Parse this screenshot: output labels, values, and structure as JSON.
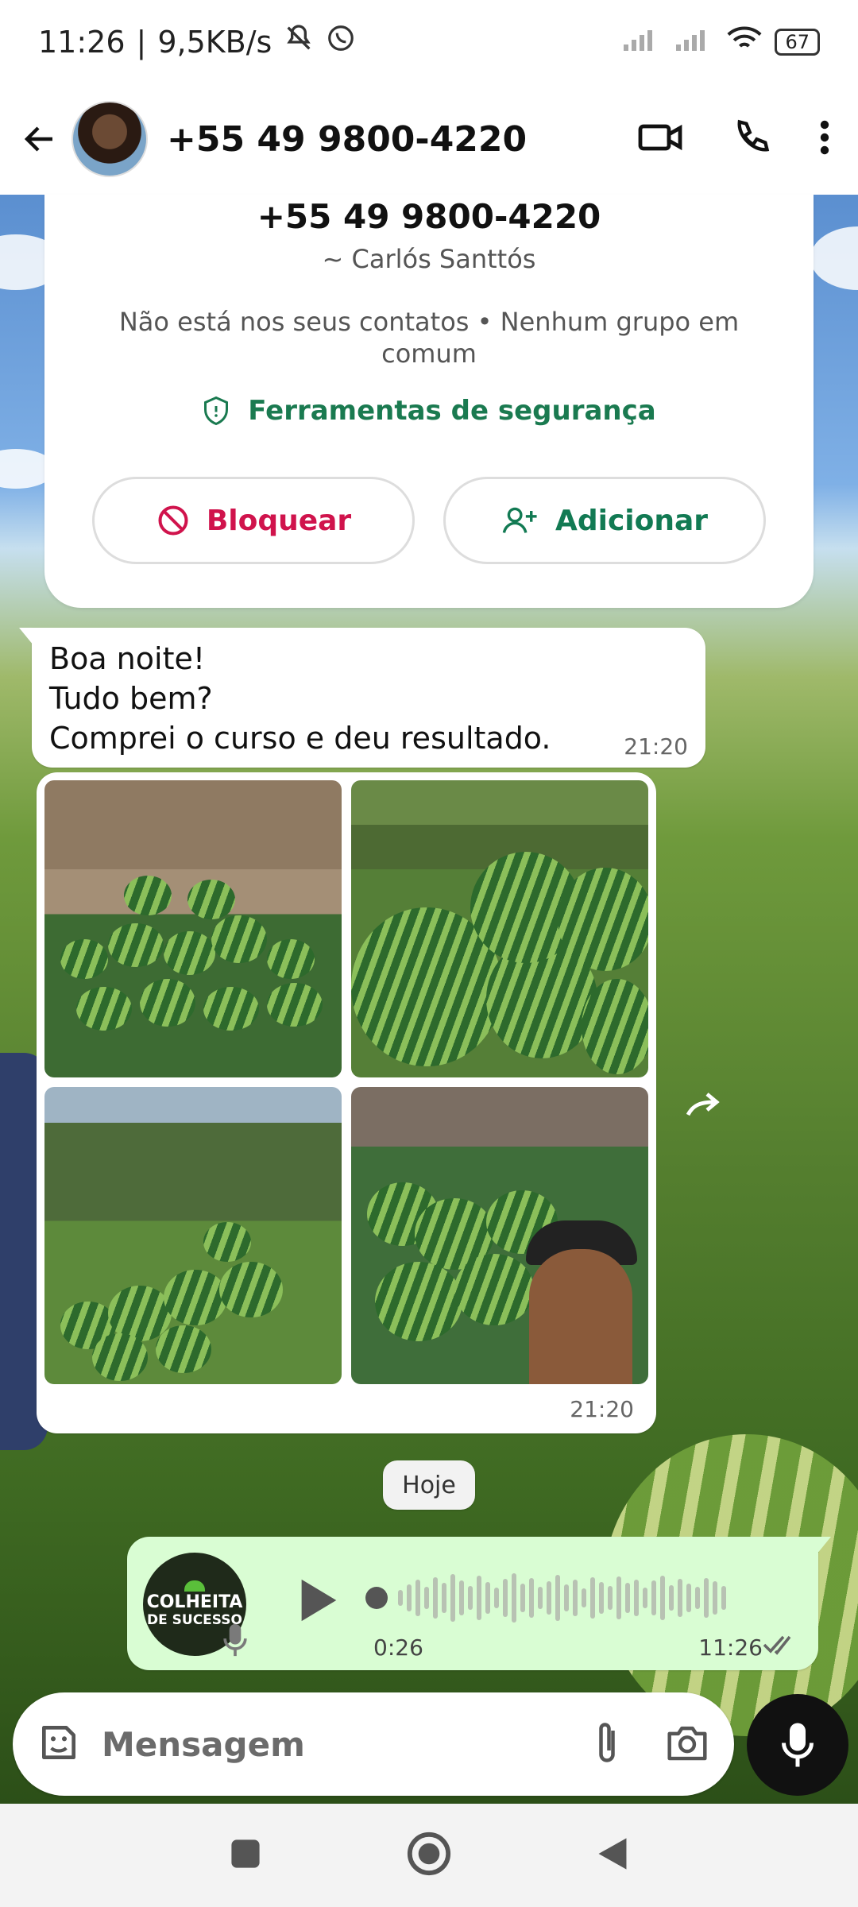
{
  "status_bar": {
    "time": "11:26",
    "separator": "|",
    "network_speed": "9,5KB/s",
    "battery": "67"
  },
  "header": {
    "title": "+55 49 9800-4220"
  },
  "contact_card": {
    "phone": "+55 49 9800-4220",
    "name": "~ Carlós Santtós",
    "meta": "Não está nos seus contatos • Nenhum grupo em comum",
    "security_label": "Ferramentas de segurança",
    "block_label": "Bloquear",
    "add_label": "Adicionar"
  },
  "messages": [
    {
      "lines": [
        "Boa noite!",
        "Tudo bem?",
        "Comprei o curso e deu resultado."
      ],
      "time": "21:20"
    },
    {
      "type": "album",
      "time": "21:20"
    }
  ],
  "date_chip": "Hoje",
  "voice_note": {
    "avatar_text_line1": "COLHEITA",
    "avatar_text_line2": "DE SUCESSO",
    "duration": "0:26",
    "time": "11:26"
  },
  "input": {
    "placeholder": "Mensagem"
  },
  "icons": {
    "back": "arrow-left-icon",
    "video": "video-camera-icon",
    "call": "phone-icon",
    "more": "more-vertical-icon",
    "emoji": "sticker-icon",
    "attach": "paperclip-icon",
    "camera": "camera-icon",
    "mic": "mic-icon"
  },
  "colors": {
    "accent_green": "#127a53",
    "danger_red": "#d0134c",
    "outgoing_bubble": "#d9fdd3"
  }
}
